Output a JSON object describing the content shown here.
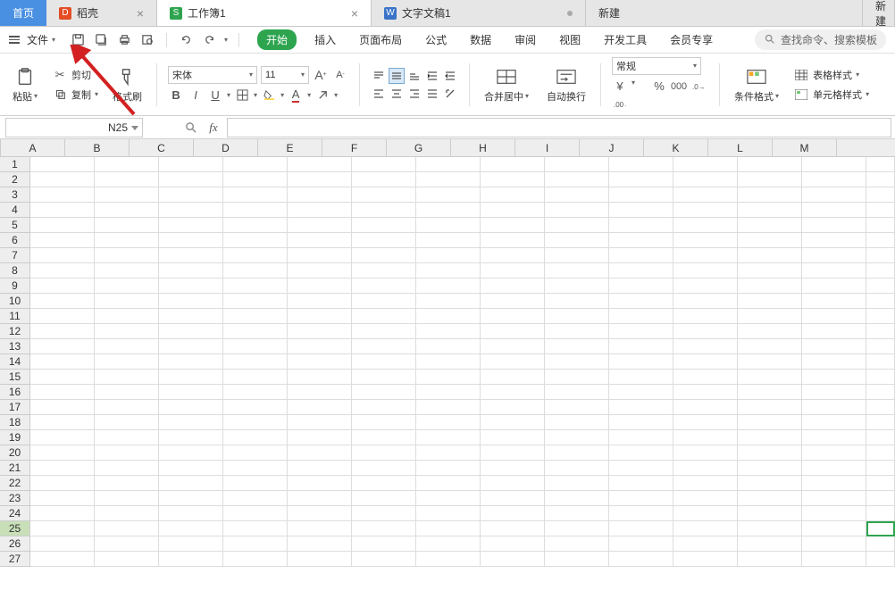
{
  "tabs": {
    "home": "首页",
    "daoke": "稻壳",
    "workbook": "工作簿1",
    "doc": "文字文稿1",
    "newtab": "新建",
    "newtab2": "新建"
  },
  "menu": {
    "file": "文件"
  },
  "ribbon_tabs": {
    "begin": "开始",
    "insert": "插入",
    "layout": "页面布局",
    "formula": "公式",
    "data": "数据",
    "review": "审阅",
    "view": "视图",
    "dev": "开发工具",
    "member": "会员专享"
  },
  "search": {
    "placeholder": "查找命令、搜索模板"
  },
  "toolbar": {
    "paste": "粘贴",
    "cut": "剪切",
    "copy": "复制",
    "fmtpaint": "格式刷",
    "font_name": "宋体",
    "font_size": "11",
    "merge": "合并居中",
    "wrap": "自动换行",
    "numfmt": "常规",
    "condfmt": "条件格式",
    "tablestyle": "表格样式",
    "cellstyle": "单元格样式"
  },
  "namebox": "N25",
  "columns": [
    "A",
    "B",
    "C",
    "D",
    "E",
    "F",
    "G",
    "H",
    "I",
    "J",
    "K",
    "L",
    "M"
  ],
  "rows": [
    1,
    2,
    3,
    4,
    5,
    6,
    7,
    8,
    9,
    10,
    11,
    12,
    13,
    14,
    15,
    16,
    17,
    18,
    19,
    20,
    21,
    22,
    23,
    24,
    25,
    26,
    27
  ],
  "selected_row": 25
}
